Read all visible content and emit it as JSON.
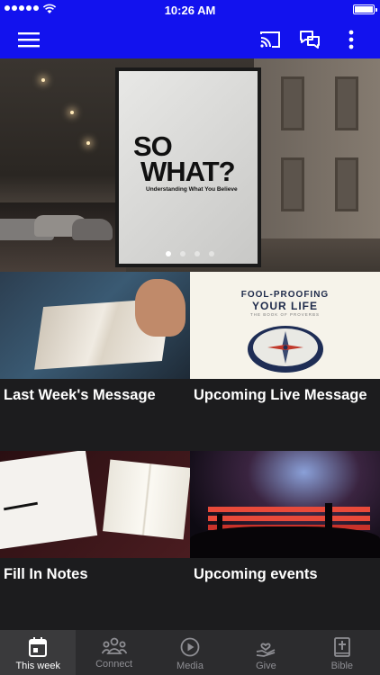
{
  "status_bar": {
    "time": "10:26 AM"
  },
  "hero": {
    "poster_line1": "SO",
    "poster_line2": "WHAT?",
    "poster_subtitle": "Understanding What You Believe",
    "pages": 4,
    "active_page": 1
  },
  "cards": [
    {
      "label": "Last Week's Message",
      "image": "open-bible-photo"
    },
    {
      "label": "Upcoming Live Message",
      "image": "fool-proofing-compass-graphic",
      "art_title": "FOOL-PROOFING",
      "art_title2": "YOUR LIFE",
      "art_sub": "THE BOOK OF PROVERBS"
    },
    {
      "label": "Fill In Notes",
      "image": "notebook-and-bible-photo"
    },
    {
      "label": "Upcoming events",
      "image": "concert-crowd-photo"
    }
  ],
  "tabs": [
    {
      "label": "This week",
      "icon": "calendar-icon",
      "active": true
    },
    {
      "label": "Connect",
      "icon": "people-icon",
      "active": false
    },
    {
      "label": "Media",
      "icon": "play-icon",
      "active": false
    },
    {
      "label": "Give",
      "icon": "giving-hand-icon",
      "active": false
    },
    {
      "label": "Bible",
      "icon": "bible-icon",
      "active": false
    }
  ],
  "colors": {
    "header": "#1212ee",
    "background": "#1c1c1e",
    "tabbar": "#2c2c2e"
  }
}
